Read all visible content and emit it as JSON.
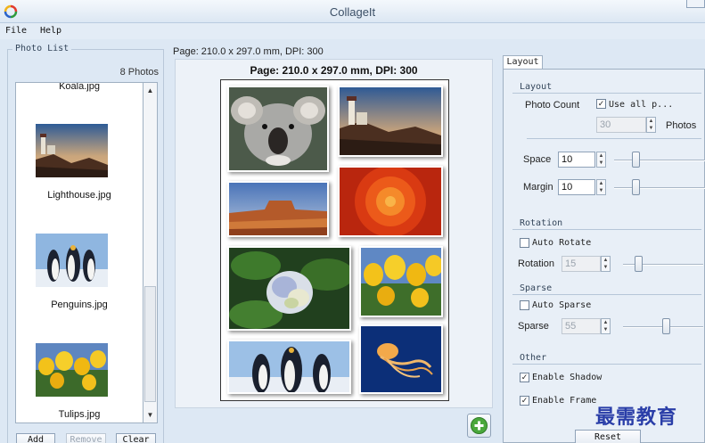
{
  "window": {
    "title": "CollageIt"
  },
  "menu": {
    "items": [
      "File",
      "Help"
    ]
  },
  "photo_list": {
    "legend": "Photo List",
    "count": "8 Photos",
    "items": [
      {
        "label": "Koala.jpg"
      },
      {
        "label": "Lighthouse.jpg"
      },
      {
        "label": "Penguins.jpg"
      },
      {
        "label": "Tulips.jpg"
      }
    ],
    "buttons": {
      "add": "Add",
      "remove": "Remove",
      "clear": "Clear"
    }
  },
  "preview": {
    "page_info": "Page: 210.0 x 297.0 mm, DPI: 300",
    "heading": "Page: 210.0 x 297.0 mm, DPI: 300"
  },
  "options": {
    "tab": "Layout",
    "layout": {
      "legend": "Layout",
      "photo_count_label": "Photo Count",
      "use_all_label": "Use all p...",
      "use_all_checked": true,
      "photos_value": "30",
      "photos_label": "Photos",
      "space_label": "Space",
      "space_value": "10",
      "margin_label": "Margin",
      "margin_value": "10"
    },
    "rotation": {
      "legend": "Rotation",
      "auto_label": "Auto Rotate",
      "auto_checked": false,
      "label": "Rotation",
      "value": "15"
    },
    "sparse": {
      "legend": "Sparse",
      "auto_label": "Auto Sparse",
      "auto_checked": false,
      "label": "Sparse",
      "value": "55"
    },
    "other": {
      "legend": "Other",
      "shadow_label": "Enable Shadow",
      "shadow_checked": true,
      "frame_label": "Enable Frame",
      "frame_checked": true
    },
    "reset_label": "Reset"
  },
  "watermark": "最需教育"
}
